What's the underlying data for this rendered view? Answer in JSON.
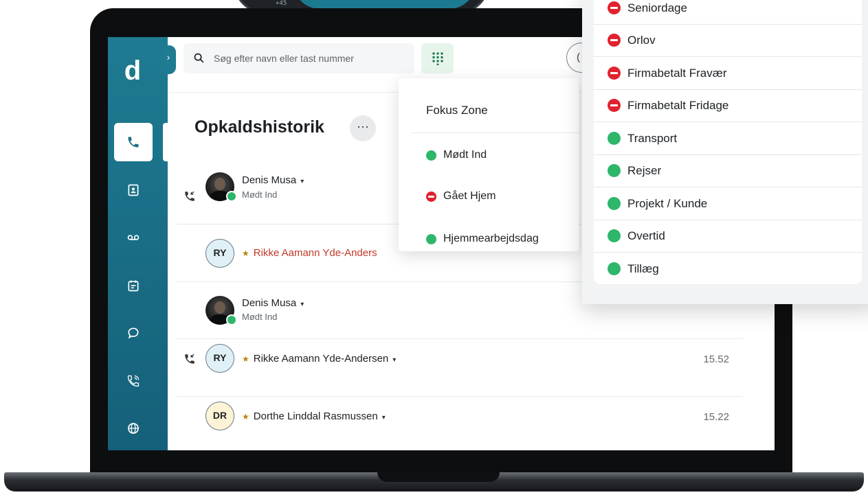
{
  "background_device": {
    "text": "+45"
  },
  "sidebar": {
    "logo": "d",
    "expand": "›",
    "items": [
      {
        "name": "phone-icon"
      },
      {
        "name": "contacts-icon"
      },
      {
        "name": "voicemail-icon"
      },
      {
        "name": "calendar-icon"
      },
      {
        "name": "chat-icon"
      },
      {
        "name": "call-forward-icon"
      },
      {
        "name": "globe-icon"
      }
    ]
  },
  "topbar": {
    "search_placeholder": "Søg efter navn eller tast nummer",
    "status_button_text": "("
  },
  "main": {
    "title": "Opkaldshistorik",
    "more": "···",
    "rows": [
      {
        "name": "Denis Musa",
        "status": "Mødt Ind",
        "time": ""
      },
      {
        "initials": "RY",
        "name": "Rikke Aamann Yde-Anders",
        "time": ""
      },
      {
        "name": "Denis Musa",
        "status": "Mødt Ind",
        "time": ""
      },
      {
        "initials": "RY",
        "name": "Rikke Aamann Yde-Andersen",
        "time": "15.52"
      },
      {
        "initials": "DR",
        "name": "Dorthe Linddal Rasmussen",
        "time": "15.22"
      }
    ]
  },
  "status_menu": {
    "title": "Fokus Zone",
    "items": [
      {
        "label": "Mødt Ind",
        "color": "green"
      },
      {
        "label": "Gået Hjem",
        "color": "red"
      },
      {
        "label": "Hjemmearbejdsdag",
        "color": "green"
      }
    ]
  },
  "status_panel": {
    "items": [
      {
        "label": "Seniordage",
        "color": "red"
      },
      {
        "label": "Orlov",
        "color": "red"
      },
      {
        "label": "Firmabetalt Fravær",
        "color": "red"
      },
      {
        "label": "Firmabetalt Fridage",
        "color": "red"
      },
      {
        "label": "Transport",
        "color": "green"
      },
      {
        "label": "Rejser",
        "color": "green"
      },
      {
        "label": "Projekt / Kunde",
        "color": "green"
      },
      {
        "label": "Overtid",
        "color": "green"
      },
      {
        "label": "Tillæg",
        "color": "green"
      }
    ]
  },
  "colors": {
    "sidebar": "#1e7b91",
    "green": "#2eb66a",
    "red": "#e0222f",
    "missed": "#c0392b"
  }
}
